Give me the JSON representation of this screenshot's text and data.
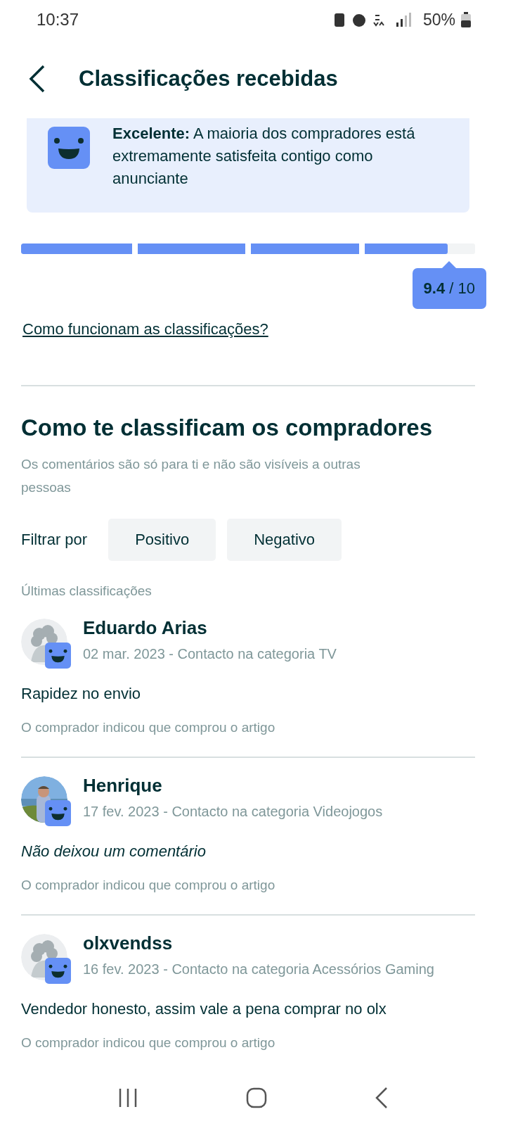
{
  "status_bar": {
    "time": "10:37",
    "battery": "50%"
  },
  "header": {
    "title": "Classificações recebidas"
  },
  "summary": {
    "text": "**Excelente:** A maioria dos compradores está extremamente satisfeita contigo como anunciante"
  },
  "score": {
    "level": 0.94,
    "value": "9.4",
    "separator": "/",
    "max": "10"
  },
  "help_link": "Como funcionam as classificações?",
  "section": {
    "title": "Como te classificam os compradores",
    "subtitle": "Os comentários são só para ti e não são visíveis a outras pessoas"
  },
  "filter": {
    "label": "Filtrar por",
    "chips": [
      {
        "label": "Positivo",
        "selected": false
      },
      {
        "label": "Negativo",
        "selected": false
      }
    ]
  },
  "list_title": "Últimas classificações",
  "reviews": [
    {
      "name": "Eduardo Arias",
      "has_photo": false,
      "meta": "02 mar. 2023 - Contacto na categoria TV",
      "comment_missing": false,
      "comment": "Rapidez no envio",
      "note": "O comprador indicou que comprou o artigo"
    },
    {
      "name": "Henrique",
      "has_photo": true,
      "meta": "17 fev. 2023 - Contacto na categoria Videojogos",
      "comment_missing": true,
      "comment": "Não deixou um comentário",
      "note": "O comprador indicou que comprou o artigo"
    },
    {
      "name": "olxvendss",
      "has_photo": false,
      "meta": "16 fev. 2023 - Contacto na categoria Acessórios Gaming",
      "comment_missing": false,
      "comment": "Vendedor honesto, assim vale a pena comprar no olx",
      "note": "O comprador indicou que comprou o artigo"
    }
  ]
}
